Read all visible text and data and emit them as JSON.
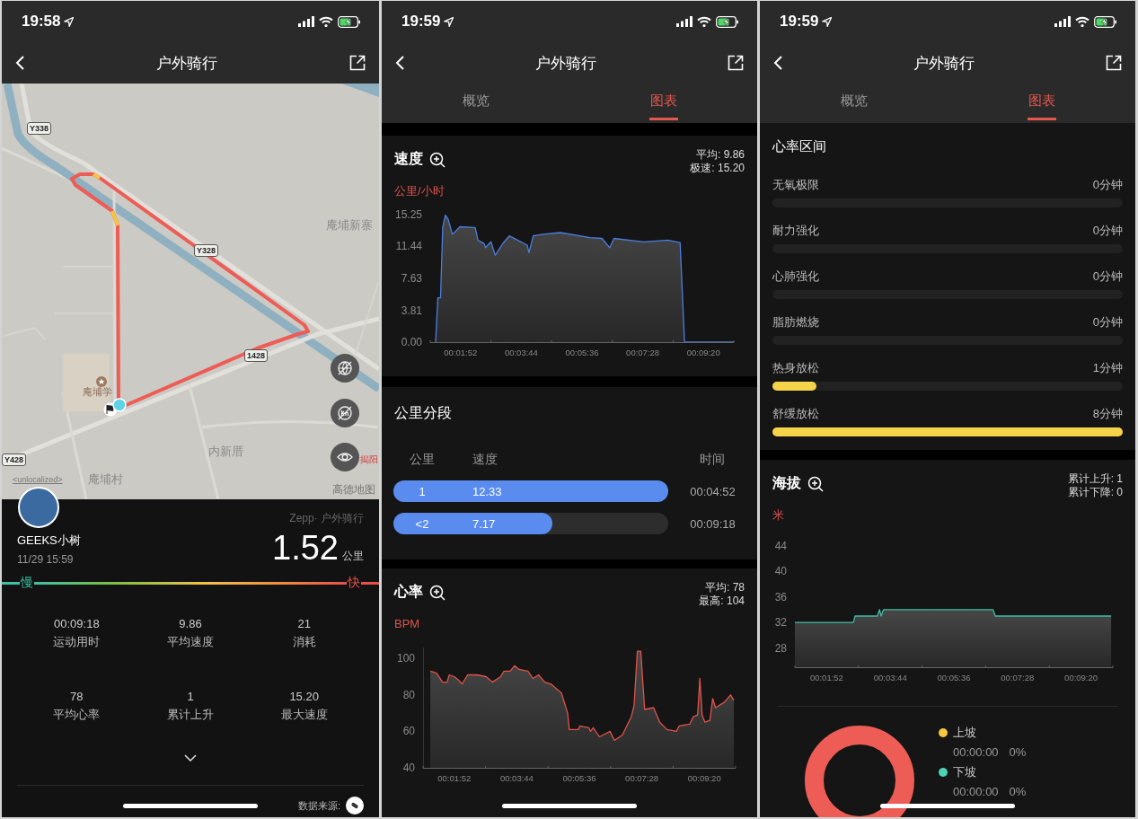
{
  "route_screen": {
    "status_bar": {
      "time": "19:58"
    },
    "nav": {
      "title": "户外骑行"
    },
    "map": {
      "road_labels": [
        "Y338",
        "Y328",
        "1428",
        "Y428"
      ],
      "place_labels": [
        "庵埔新寨",
        "内新厝",
        "庵埔村",
        "庵埔学"
      ],
      "city_label": "揭阳",
      "attribution_link": "<unlocalized>",
      "provider": "高德地图"
    },
    "summary": {
      "user": "GEEKS小树",
      "datetime": "11/29 15:59",
      "source": "Zepp· 户外骑行",
      "distance": "1.52",
      "distance_unit": "公里",
      "pace_scale": {
        "slow": "慢",
        "fast": "快"
      },
      "stats": [
        {
          "value": "00:09:18",
          "label": "运动用时"
        },
        {
          "value": "9.86",
          "label": "平均速度"
        },
        {
          "value": "21",
          "label": "消耗"
        },
        {
          "value": "78",
          "label": "平均心率"
        },
        {
          "value": "1",
          "label": "累计上升"
        },
        {
          "value": "15.20",
          "label": "最大速度"
        }
      ],
      "data_source_label": "数据来源:"
    }
  },
  "charts_screen": {
    "status_bar": {
      "time": "19:59"
    },
    "nav": {
      "title": "户外骑行"
    },
    "tabs": [
      {
        "label": "概览",
        "selected": false
      },
      {
        "label": "图表",
        "selected": true
      }
    ],
    "speed": {
      "title": "速度",
      "stats": [
        "平均: 9.86",
        "极速: 15.20"
      ],
      "unit": "公里/小时",
      "chart_data": {
        "type": "area",
        "x": [
          66,
          70,
          75,
          79,
          84,
          89,
          97,
          111,
          139,
          144,
          155,
          158,
          168,
          176,
          191,
          202,
          235,
          238,
          246,
          263,
          296,
          351,
          373,
          387,
          395,
          450,
          494,
          517,
          521,
          525,
          616
        ],
        "series": [
          {
            "color": "#4a7fe0",
            "values": [
              0,
              5.3,
              5.3,
              13.7,
              15.2,
              14.7,
              12.9,
              13.8,
              13.7,
              12.2,
              11.8,
              11.3,
              12.0,
              10.4,
              11.9,
              12.7,
              11.6,
              10.7,
              12.7,
              12.9,
              13.1,
              12.5,
              12.4,
              11.3,
              12.4,
              12.0,
              12.2,
              11.9,
              5.9,
              0,
              0
            ]
          }
        ],
        "xlim": [
          56,
          616
        ],
        "ylim": [
          0,
          15.25
        ],
        "xticks": [
          {
            "value": 112,
            "label": "00:01:52"
          },
          {
            "value": 224,
            "label": "00:03:44"
          },
          {
            "value": 336,
            "label": "00:05:36"
          },
          {
            "value": 448,
            "label": "00:07:28"
          },
          {
            "value": 560,
            "label": "00:09:20"
          }
        ],
        "yticks": [
          {
            "value": 0,
            "label": "0.00"
          },
          {
            "value": 3.81,
            "label": "3.81"
          },
          {
            "value": 7.63,
            "label": "7.63"
          },
          {
            "value": 11.44,
            "label": "11.44"
          },
          {
            "value": 15.25,
            "label": "15.25"
          }
        ]
      }
    },
    "splits": {
      "title": "公里分段",
      "columns": [
        "公里",
        "速度",
        "时间"
      ],
      "rows": [
        {
          "km": "1",
          "speed": "12.33",
          "time": "00:04:52",
          "level": 1
        },
        {
          "km": "<2",
          "speed": "7.17",
          "time": "00:09:18",
          "level": 0.58
        }
      ]
    },
    "heart_rate": {
      "title": "心率",
      "stats": [
        "平均: 78",
        "最高: 104"
      ],
      "unit": "BPM",
      "chart_data": {
        "type": "area",
        "x": [
          69,
          80,
          91,
          99,
          103,
          112,
          120,
          126,
          136,
          153,
          169,
          180,
          195,
          201,
          212,
          220,
          228,
          244,
          253,
          263,
          274,
          285,
          304,
          315,
          318,
          334,
          337,
          353,
          356,
          361,
          372,
          391,
          399,
          413,
          429,
          434,
          440,
          446,
          453,
          469,
          480,
          493,
          510,
          515,
          534,
          540,
          548,
          552,
          556,
          561,
          570,
          575,
          580,
          596,
          607,
          613
        ],
        "series": [
          {
            "color": "#e0524a",
            "values": [
              93,
              92,
              87,
              87,
              91,
              90,
              88,
              86,
              91,
              91,
              90,
              87,
              90,
              93,
              93,
              96,
              94,
              93,
              89,
              91,
              87,
              86,
              81,
              70,
              61,
              61,
              63,
              62,
              60,
              62,
              57,
              60,
              55,
              58,
              68,
              74,
              104,
              104,
              72,
              73,
              65,
              61,
              60,
              63,
              64,
              68,
              69,
              89,
              69,
              65,
              66,
              78,
              73,
              76,
              80,
              77
            ]
          }
        ],
        "xlim": [
          56,
          616
        ],
        "xticks": [
          {
            "value": 112,
            "label": "00:01:52"
          },
          {
            "value": 224,
            "label": "00:03:44"
          },
          {
            "value": 336,
            "label": "00:05:36"
          },
          {
            "value": 448,
            "label": "00:07:28"
          },
          {
            "value": 560,
            "label": "00:09:20"
          }
        ],
        "ylim": [
          40,
          106
        ],
        "yticks": [
          40,
          60,
          80,
          100
        ]
      }
    }
  },
  "zones_screen": {
    "status_bar": {
      "time": "19:59"
    },
    "nav": {
      "title": "户外骑行"
    },
    "tabs": [
      {
        "label": "概览",
        "selected": false
      },
      {
        "label": "图表",
        "selected": true
      }
    ],
    "zones": {
      "title": "心率区间",
      "items": [
        {
          "label": "无氧极限",
          "value": "0分钟"
        },
        {
          "label": "耐力强化",
          "value": "0分钟"
        },
        {
          "label": "心肺强化",
          "value": "0分钟"
        },
        {
          "label": "脂肪燃烧",
          "value": "0分钟"
        },
        {
          "label": "热身放松",
          "value": "1分钟",
          "level": 0.125
        },
        {
          "label": "舒缓放松",
          "value": "8分钟",
          "level": 1
        }
      ]
    },
    "altitude": {
      "title": "海拔",
      "stats": [
        "累计上升: 1",
        "累计下降: 0"
      ],
      "unit": "米",
      "chart_data": {
        "type": "area",
        "x": [
          56,
          159,
          162,
          201,
          205,
          208,
          212,
          405,
          409,
          613
        ],
        "series": [
          {
            "color": "#3fbfa8",
            "values": [
              32,
              32,
              33,
              33,
              34,
              33,
              34,
              34,
              33,
              33
            ]
          }
        ],
        "xlim": [
          56,
          616
        ],
        "xticks": [
          {
            "value": 112,
            "label": "00:01:52"
          },
          {
            "value": 224,
            "label": "00:03:44"
          },
          {
            "value": 336,
            "label": "00:05:36"
          },
          {
            "value": 448,
            "label": "00:07:28"
          },
          {
            "value": 560,
            "label": "00:09:20"
          }
        ],
        "ylim": [
          25,
          44
        ],
        "yticks": [
          28,
          32,
          36,
          40,
          44
        ]
      },
      "slopes": [
        {
          "label": "上坡",
          "time": "00:00:00",
          "share": "0%",
          "color": "#f5c842"
        },
        {
          "label": "下坡",
          "time": "00:00:00",
          "share": "0%",
          "color": "#4fd1b5"
        }
      ]
    }
  }
}
